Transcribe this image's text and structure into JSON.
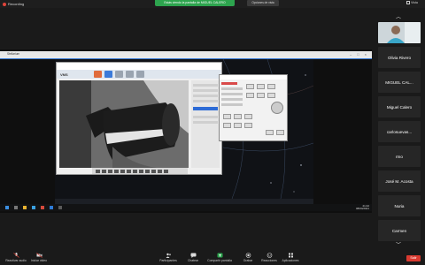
{
  "topbar": {
    "recording": "Recording",
    "share_banner": "Estás viendo la pantalla de MIGUEL CALERO",
    "view_options": "Opciones de vista",
    "vista": "Vista"
  },
  "shared_screen": {
    "desktop_title": "Stellarium",
    "app_title": "VMS",
    "taskbar_time": "21:42",
    "taskbar_date": "08/04/2021"
  },
  "participants": [
    {
      "name": "",
      "video": true
    },
    {
      "name": "Olivia Rivero"
    },
    {
      "name": "MIGUEL CAL..."
    },
    {
      "name": "Miguel Calero"
    },
    {
      "name": "carlosuevas..."
    },
    {
      "name": "rmo"
    },
    {
      "name": "José M. Acosta"
    },
    {
      "name": "Nuria"
    },
    {
      "name": "Carmen"
    }
  ],
  "toolbar": {
    "audio": "Reactivar audio",
    "video": "Iniciar video",
    "participants": "Participantes",
    "participants_count": "24",
    "chat": "Chatear",
    "share": "Compartir pantalla",
    "record": "Grabar",
    "reactions": "Reacciones",
    "apps": "Aplicaciones",
    "leave": "Salir"
  },
  "colors": {
    "accent_green": "#2da44e",
    "leave_red": "#d93a30",
    "rec_red": "#e0443a"
  }
}
